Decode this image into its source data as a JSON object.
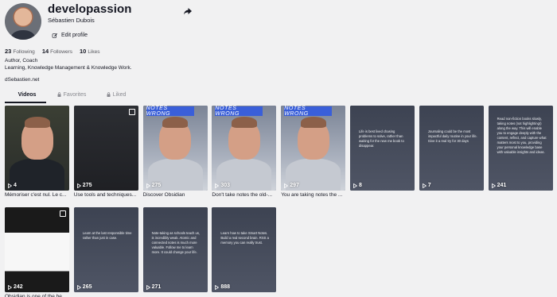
{
  "profile": {
    "username": "developassion",
    "fullname": "Sébastien Dubois",
    "edit_label": "Edit profile",
    "stats": [
      {
        "value": "23",
        "label": "Following"
      },
      {
        "value": "14",
        "label": "Followers"
      },
      {
        "value": "10",
        "label": "Likes"
      }
    ],
    "bio_line1": "Author, Coach",
    "bio_line2": "Learning, Knowledge Management & Knowledge Work.",
    "link": "dSebastien.net"
  },
  "tabs": [
    {
      "label": "Videos",
      "locked": false,
      "active": true
    },
    {
      "label": "Favorites",
      "locked": true,
      "active": false
    },
    {
      "label": "Liked",
      "locked": true,
      "active": false
    }
  ],
  "videos": [
    {
      "views": "4",
      "caption": "Mémoriser c'est nul. Le c..."
    },
    {
      "views": "275",
      "caption": "Use tools and techniques..."
    },
    {
      "views": "275",
      "caption": "Discover Obsidian",
      "banner": "NOTES WRONG"
    },
    {
      "views": "303",
      "caption": "Don't take notes the old-...",
      "banner": "NOTES WRONG"
    },
    {
      "views": "297",
      "caption": "You are taking notes the ...",
      "banner": "NOTES WRONG"
    },
    {
      "views": "8",
      "caption": "",
      "text": "Life is best lived chasing problems to solve, rather than waiting for the new me book to disappear."
    },
    {
      "views": "7",
      "caption": "",
      "text": "Journaling could be the most impactful daily routine in your life. Give it a real try for 30 days"
    },
    {
      "views": "241",
      "caption": "",
      "text": "Read non-fiction books slowly, taking notes (not highlighting!) along the way. This will enable you to engage deeply with the content, reflect, and capture what matters most to you, providing your personal knowledge base with valuable insights and ideas."
    },
    {
      "views": "242",
      "caption": "Obsidian is one of the be...",
      "banner": ""
    },
    {
      "views": "265",
      "caption": "",
      "text": "Learn at the last responsible time rather than just in case."
    },
    {
      "views": "271",
      "caption": "",
      "text": "Note-taking as schools teach us, is incredibly weak. Atomic and connected notes is much more valuable. Follow me to learn more. It could change your life."
    },
    {
      "views": "888",
      "caption": "",
      "text": "Learn how to take Smart Notes. Build a real second brain. RSS a memory you can really trust."
    }
  ]
}
